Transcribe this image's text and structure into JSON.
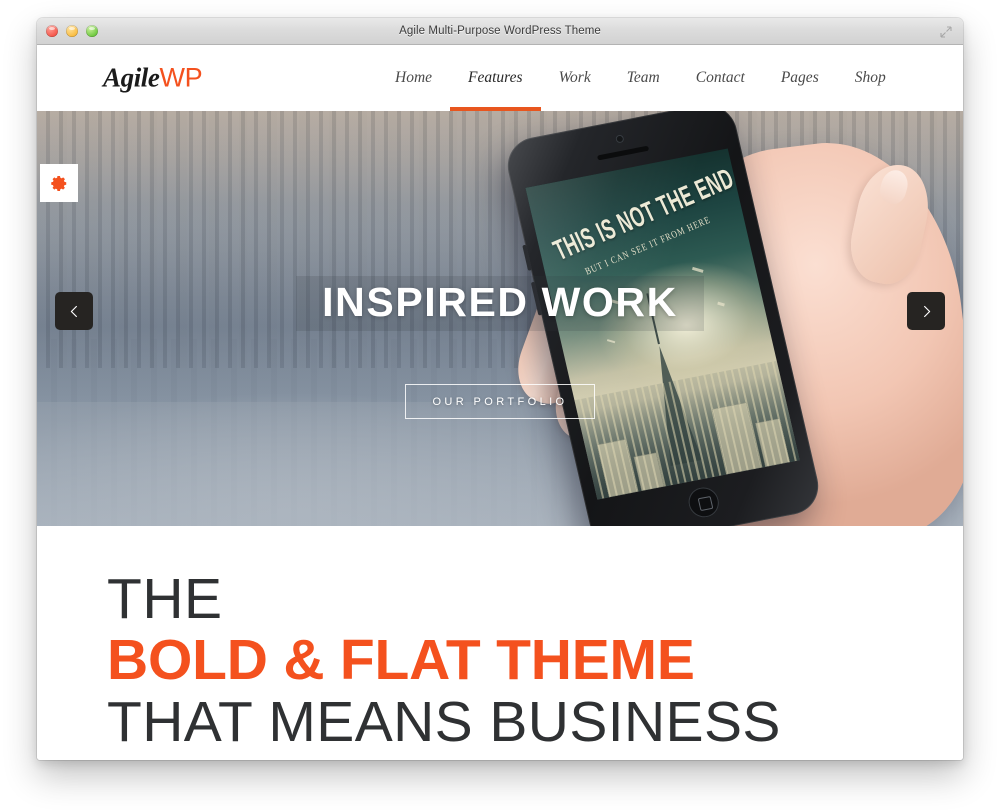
{
  "window": {
    "title": "Agile Multi-Purpose WordPress Theme",
    "controls": {
      "close_label": "close",
      "minimize_label": "minimize",
      "zoom_label": "zoom",
      "resize_label": "resize"
    }
  },
  "site": {
    "logo": {
      "part_primary": "Agile",
      "part_accent": "WP"
    },
    "nav": {
      "items": [
        {
          "label": "Home",
          "active": false
        },
        {
          "label": "Features",
          "active": true
        },
        {
          "label": "Work",
          "active": false
        },
        {
          "label": "Team",
          "active": false
        },
        {
          "label": "Contact",
          "active": false
        },
        {
          "label": "Pages",
          "active": false
        },
        {
          "label": "Shop",
          "active": false
        }
      ]
    }
  },
  "hero": {
    "settings_icon": "gear-icon",
    "prev_icon": "chevron-left-icon",
    "next_icon": "chevron-right-icon",
    "slide": {
      "title": "INSPIRED WORK",
      "cta_label": "OUR PORTFOLIO"
    },
    "phone": {
      "wallpaper_title": "THIS IS NOT THE END",
      "wallpaper_subtitle": "BUT I CAN SEE IT FROM HERE"
    }
  },
  "promo": {
    "line1": "THE",
    "line2": "BOLD & FLAT THEME",
    "line3": "THAT MEANS BUSINESS"
  },
  "colors": {
    "accent_orange": "#f4511e",
    "nav_underline": "#e8561e",
    "text_dark": "#2f3133",
    "window_chrome": "#dcdcdc"
  }
}
